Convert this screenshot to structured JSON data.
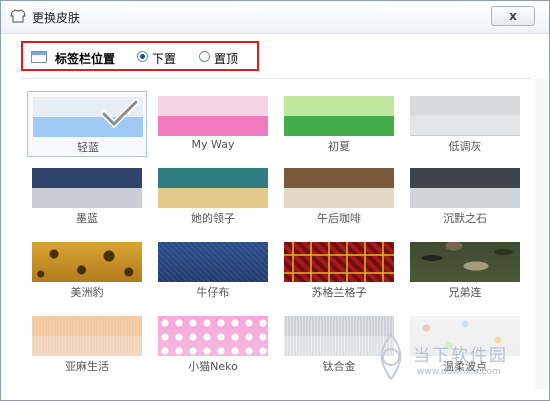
{
  "window": {
    "title": "更换皮肤",
    "close_label": "x"
  },
  "tab_position": {
    "label": "标签栏位置",
    "options": [
      {
        "label": "下置",
        "selected": true
      },
      {
        "label": "置顶",
        "selected": false
      }
    ]
  },
  "skins": [
    {
      "name": "轻蓝",
      "icon": "light-blue-swatch",
      "top": "#e8eef6",
      "bottom": "#9fcaf4",
      "selected": true
    },
    {
      "name": "My Way",
      "icon": "pink-swatch",
      "top": "#f9d4e4",
      "bottom": "#f07cbf",
      "selected": false
    },
    {
      "name": "初夏",
      "icon": "green-swatch",
      "top": "#bfe79d",
      "bottom": "#45ad4b",
      "selected": false
    },
    {
      "name": "低调灰",
      "icon": "gray-swatch",
      "top": "#d7d9da",
      "bottom": "#dcdedf",
      "selected": false
    },
    {
      "name": "墨蓝",
      "icon": "navy-swatch",
      "top": "#2f456c",
      "bottom": "#c9ced6",
      "selected": false
    },
    {
      "name": "她的领子",
      "icon": "teal-gold-swatch",
      "top": "#2f7f80",
      "bottom": "#e3c98a",
      "selected": false
    },
    {
      "name": "午后咖啡",
      "icon": "coffee-swatch",
      "top": "#7a5a3a",
      "bottom": "#e3d7c5",
      "selected": false
    },
    {
      "name": "沉默之石",
      "icon": "stone-swatch",
      "top": "#3e444c",
      "bottom": "#d1d4d8",
      "selected": false
    },
    {
      "name": "美洲豹",
      "icon": "leopard-swatch",
      "top": "#d8a531",
      "bottom": "#8a5c14",
      "selected": false
    },
    {
      "name": "牛仔布",
      "icon": "denim-swatch",
      "top": "#2c4c8a",
      "bottom": "#223c70",
      "selected": false
    },
    {
      "name": "苏格兰格子",
      "icon": "tartan-swatch",
      "top": "#a51a1a",
      "bottom": "#6f0f0f",
      "selected": false
    },
    {
      "name": "兄弟连",
      "icon": "camo-swatch",
      "top": "#3f4a2f",
      "bottom": "#776a4c",
      "selected": false
    },
    {
      "name": "亚麻生活",
      "icon": "linen-swatch",
      "top": "#f2c9a1",
      "bottom": "#f1d6bd",
      "selected": false
    },
    {
      "name": "小猫Neko",
      "icon": "cat-pattern-swatch",
      "top": "#f7a7d9",
      "bottom": "#f4b9e0",
      "selected": false
    },
    {
      "name": "钛合金",
      "icon": "titanium-swatch",
      "top": "#cfd2d5",
      "bottom": "#dfe1e3",
      "selected": false
    },
    {
      "name": "温柔波点",
      "icon": "polka-dot-swatch",
      "top": "#f4f4f4",
      "bottom": "#eeeeee",
      "selected": false
    }
  ],
  "watermark": {
    "text": "当下软件园",
    "url": "www.downxia.com"
  }
}
